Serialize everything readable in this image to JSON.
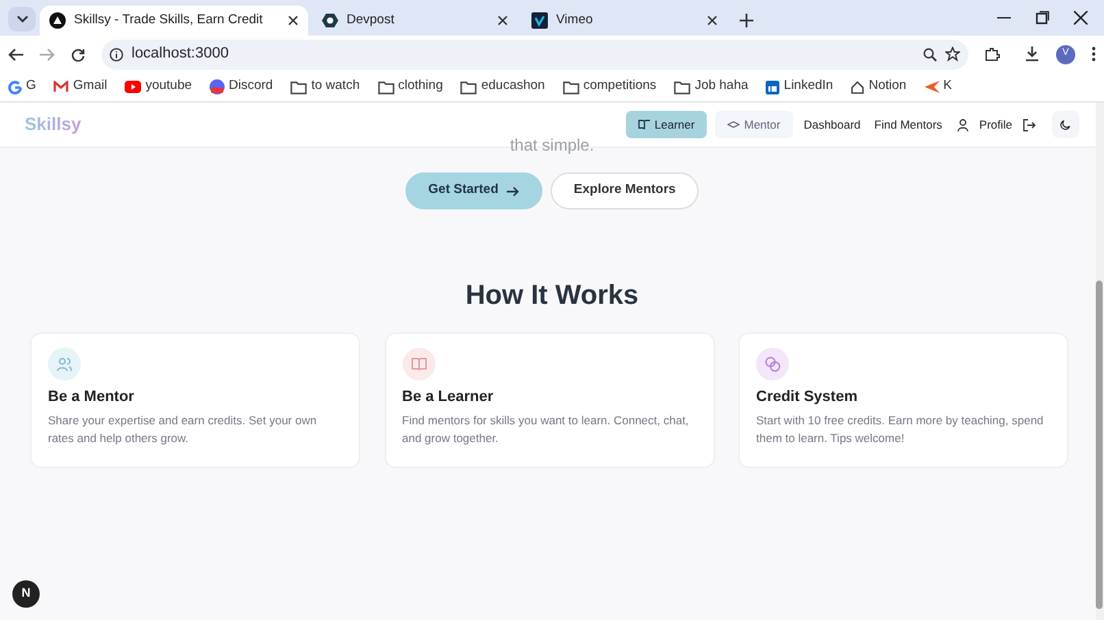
{
  "browser": {
    "tabs": [
      {
        "title": "Skillsy - Trade Skills, Earn Credit",
        "selected": true
      },
      {
        "title": "Devpost",
        "selected": false
      },
      {
        "title": "Vimeo",
        "selected": false
      }
    ],
    "address": "localhost:3000",
    "profile_initial": "V",
    "bookmarks": [
      {
        "label": "G",
        "kind": "google"
      },
      {
        "label": "Gmail",
        "kind": "gmail"
      },
      {
        "label": "youtube",
        "kind": "youtube"
      },
      {
        "label": "Discord",
        "kind": "discord"
      },
      {
        "label": "to watch",
        "kind": "folder"
      },
      {
        "label": "clothing",
        "kind": "folder"
      },
      {
        "label": "educashon",
        "kind": "folder"
      },
      {
        "label": "competitions",
        "kind": "folder"
      },
      {
        "label": "Job haha",
        "kind": "folder"
      },
      {
        "label": "LinkedIn",
        "kind": "linkedin"
      },
      {
        "label": "Notion",
        "kind": "page"
      },
      {
        "label": "K",
        "kind": "site"
      }
    ]
  },
  "navbar": {
    "brand": "Skillsy",
    "modes": [
      {
        "label": "Learner",
        "selected": true
      },
      {
        "label": "Mentor",
        "selected": false
      }
    ],
    "links": [
      "Dashboard",
      "Find Mentors",
      "Profile"
    ]
  },
  "hero": {
    "text_tail": "that simple.",
    "buttons": [
      {
        "label": "Get Started",
        "kind": "primary"
      },
      {
        "label": "Explore Mentors",
        "kind": "outline"
      }
    ]
  },
  "how_it_works": {
    "title": "How It Works",
    "cards": [
      {
        "title": "Be a Mentor",
        "text": "Share your expertise and earn credits. Set your own rates and help others grow.",
        "color": "#e6f3f7"
      },
      {
        "title": "Be a Learner",
        "text": "Find mentors for skills you want to learn. Connect, chat, and grow together.",
        "color": "#fbeaea"
      },
      {
        "title": "Credit System",
        "text": "Start with 10 free credits. Earn more by teaching, spend them to learn. Tips welcome!",
        "color": "#f3e6fa"
      }
    ]
  },
  "dev_badge": "N"
}
